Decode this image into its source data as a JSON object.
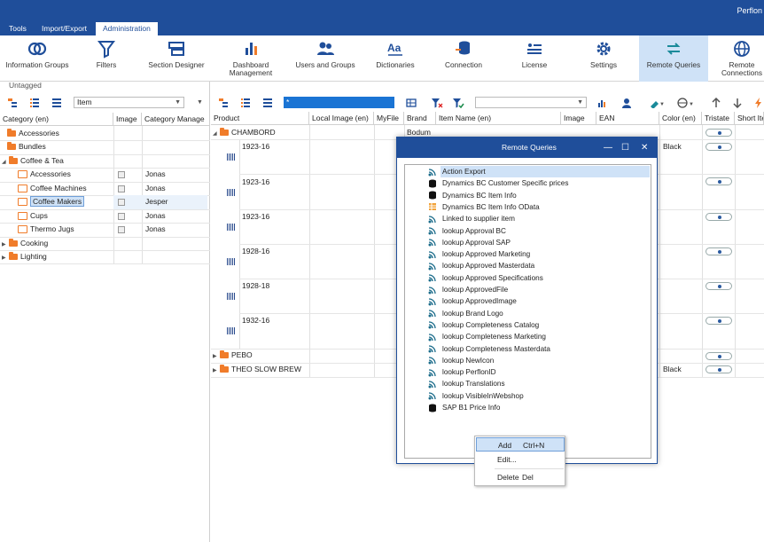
{
  "app": {
    "name": "Perflon"
  },
  "tabs": [
    {
      "label": "Tools"
    },
    {
      "label": "Import/Export"
    },
    {
      "label": "Administration",
      "active": true
    }
  ],
  "ribbon": [
    {
      "label": "Information Groups",
      "icon": "information-groups-icon"
    },
    {
      "label": "Filters",
      "icon": "filter-icon"
    },
    {
      "label": "Section Designer",
      "icon": "section-designer-icon"
    },
    {
      "label": "Dashboard Management",
      "icon": "dashboard-icon"
    },
    {
      "label": "Users and Groups",
      "icon": "users-icon"
    },
    {
      "label": "Dictionaries",
      "icon": "dictionaries-icon"
    },
    {
      "label": "Connection",
      "icon": "connection-icon"
    },
    {
      "label": "License",
      "icon": "license-icon"
    },
    {
      "label": "Settings",
      "icon": "gear-icon"
    },
    {
      "label": "Remote Queries",
      "icon": "remote-queries-icon",
      "selected": true
    },
    {
      "label": "Remote Connections",
      "icon": "globe-icon"
    }
  ],
  "left": {
    "untagged": "Untagged",
    "dropdown": "Item",
    "headers": [
      "Category (en)",
      "Image",
      "Category Manage"
    ],
    "rows": [
      {
        "label": "Accessories",
        "manager": "",
        "level": 0
      },
      {
        "label": "Bundles",
        "manager": "",
        "level": 0
      },
      {
        "label": "Coffee & Tea",
        "manager": "",
        "level": 0,
        "expanded": true
      },
      {
        "label": "Accessories",
        "manager": "Jonas",
        "level": 1
      },
      {
        "label": "Coffee Machines",
        "manager": "Jonas",
        "level": 1
      },
      {
        "label": "Coffee Makers",
        "manager": "Jesper",
        "level": 1,
        "selected": true
      },
      {
        "label": "Cups",
        "manager": "Jonas",
        "level": 1
      },
      {
        "label": "Thermo Jugs",
        "manager": "Jonas",
        "level": 1
      },
      {
        "label": "Cooking",
        "manager": "",
        "level": 0,
        "collapsed": true
      },
      {
        "label": "Lighting",
        "manager": "",
        "level": 0,
        "collapsed": true
      }
    ]
  },
  "right": {
    "search_value": "*",
    "headers": [
      "Product",
      "Local Image (en)",
      "MyFile",
      "Brand",
      "Item Name (en)",
      "Image",
      "EAN",
      "Color (en)",
      "Tristate",
      "Short Ite"
    ],
    "groups": [
      {
        "label": "CHAMBORD",
        "brand": "Bodum"
      },
      {
        "label": "PEBO"
      },
      {
        "label": "THEO SLOW BREW",
        "color": "Black"
      }
    ],
    "items": [
      "1923-16",
      "1923-16",
      "1923-16",
      "1928-16",
      "1928-18",
      "1932-16"
    ],
    "first_item_color": "Black"
  },
  "dialog": {
    "title": "Remote Queries",
    "items": [
      {
        "label": "Action Export",
        "icon": "wifi",
        "selected": true
      },
      {
        "label": "Dynamics BC Customer Specific prices",
        "icon": "database"
      },
      {
        "label": "Dynamics BC Item Info",
        "icon": "database"
      },
      {
        "label": "Dynamics BC Item Info OData",
        "icon": "table"
      },
      {
        "label": "Linked to supplier item",
        "icon": "wifi"
      },
      {
        "label": "lookup Approval BC",
        "icon": "wifi"
      },
      {
        "label": "lookup Approval SAP",
        "icon": "wifi"
      },
      {
        "label": "lookup Approved Marketing",
        "icon": "wifi"
      },
      {
        "label": "lookup Approved Masterdata",
        "icon": "wifi"
      },
      {
        "label": "lookup Approved Specifications",
        "icon": "wifi"
      },
      {
        "label": "lookup ApprovedFile",
        "icon": "wifi"
      },
      {
        "label": "lookup ApprovedImage",
        "icon": "wifi"
      },
      {
        "label": "lookup Brand Logo",
        "icon": "wifi"
      },
      {
        "label": "lookup Completeness Catalog",
        "icon": "wifi"
      },
      {
        "label": "lookup Completeness Marketing",
        "icon": "wifi"
      },
      {
        "label": "lookup Completeness Masterdata",
        "icon": "wifi"
      },
      {
        "label": "lookup NewIcon",
        "icon": "wifi"
      },
      {
        "label": "lookup PerflonID",
        "icon": "wifi"
      },
      {
        "label": "lookup Translations",
        "icon": "wifi"
      },
      {
        "label": "lookup VisibleInWebshop",
        "icon": "wifi"
      },
      {
        "label": "SAP B1 Price Info",
        "icon": "database"
      }
    ]
  },
  "context_menu": [
    {
      "label": "Add",
      "shortcut": "Ctrl+N",
      "selected": true
    },
    {
      "label": "Edit...",
      "shortcut": ""
    },
    {
      "label": "Delete",
      "shortcut": "Del"
    }
  ],
  "colors": {
    "brand": "#1f4e9a",
    "selection": "#cfe2f7",
    "folder": "#f07c2a"
  }
}
